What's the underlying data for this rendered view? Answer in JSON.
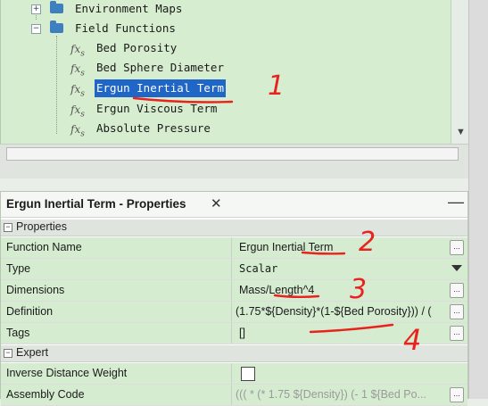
{
  "tree": {
    "items": [
      {
        "label": "Environment Maps",
        "kind": "folder",
        "expander": "+"
      },
      {
        "label": "Field Functions",
        "kind": "folder",
        "expander": "−"
      },
      {
        "label": "Bed Porosity",
        "kind": "function"
      },
      {
        "label": "Bed Sphere Diameter",
        "kind": "function"
      },
      {
        "label": "Ergun Inertial Term",
        "kind": "function",
        "selected": true
      },
      {
        "label": "Ergun Viscous Term",
        "kind": "function"
      },
      {
        "label": "Absolute Pressure",
        "kind": "function"
      }
    ],
    "fx_symbol": "fx",
    "fx_sub": "s",
    "scroll_down_icon": "▼"
  },
  "properties": {
    "title": "Ergun Inertial Term - Properties",
    "close_icon": "✕",
    "minimize_icon": "—",
    "sections": {
      "properties": {
        "label": "Properties",
        "toggle": "−"
      },
      "expert": {
        "label": "Expert",
        "toggle": "−"
      }
    },
    "rows": {
      "function_name": {
        "name": "Function Name",
        "value": "Ergun Inertial Term"
      },
      "type": {
        "name": "Type",
        "value": "Scalar"
      },
      "dimensions": {
        "name": "Dimensions",
        "value": "Mass/Length^4"
      },
      "definition": {
        "name": "Definition",
        "value": "(1.75*${Density}*(1-${Bed Porosity})) / ("
      },
      "tags": {
        "name": "Tags",
        "value": "[]"
      },
      "inverse_distance_weight": {
        "name": "Inverse Distance Weight",
        "checked": false
      },
      "assembly_code": {
        "name": "Assembly Code",
        "value": "((( * (* 1.75 ${Density}) (- 1 ${Bed Po..."
      }
    },
    "ellipsis": "..."
  },
  "annotations": {
    "color": "#e8231e",
    "labels": [
      "1",
      "2",
      "3",
      "4"
    ]
  }
}
